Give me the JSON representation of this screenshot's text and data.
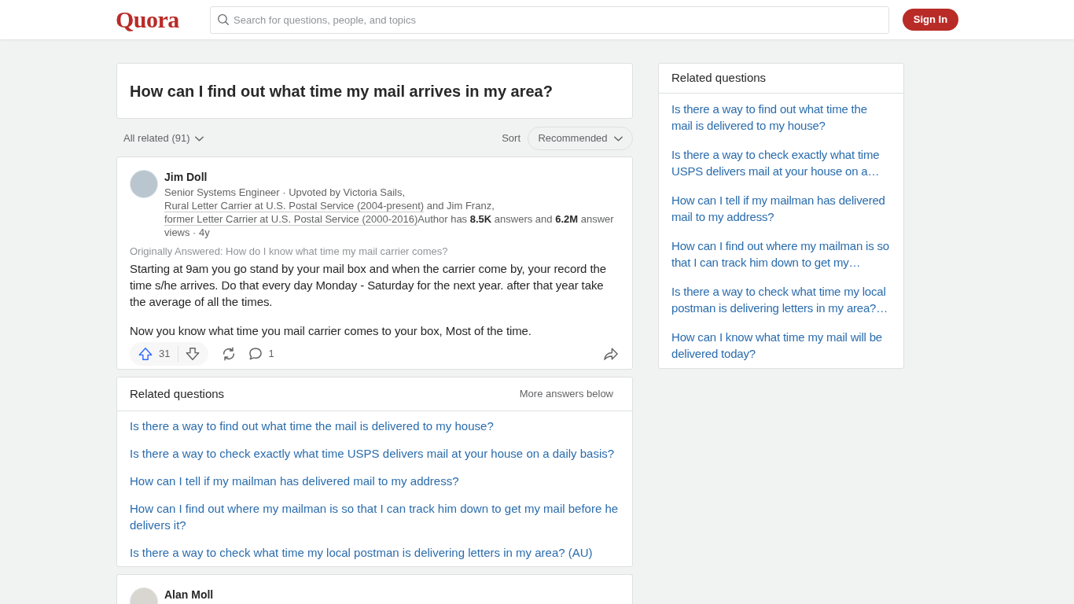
{
  "header": {
    "logo": "Quora",
    "search": {
      "placeholder": "Search for questions, people, and topics"
    },
    "sign_in": "Sign In"
  },
  "question": {
    "title": "How can I find out what time my mail arrives in my area?"
  },
  "filter_bar": {
    "all_related": "All related (91)",
    "sort_label": "Sort",
    "sort_value": "Recommended"
  },
  "answer": {
    "author": "Jim Doll",
    "credential": [
      {
        "kind": "text",
        "text": "Senior Systems Engineer · Upvoted by Victoria Sails, "
      },
      {
        "kind": "link",
        "text": "Rural Letter Carrier at U.S. Postal Service (2004-present)"
      },
      {
        "kind": "text",
        "text": " and Jim Franz, "
      },
      {
        "kind": "link",
        "text": "former Letter Carrier at U.S. Postal Service (2000-2016)"
      },
      {
        "kind": "text",
        "text": "Author has **8.5K** answers and **6.2M** answer views · 4y"
      }
    ],
    "originally_answered": "Originally Answered: How do I know what time my mail carrier comes?",
    "paragraphs": [
      "Starting at 9am you go stand by your mail box and when the carrier come by, your record the time s/he arrives. Do that every day Monday - Saturday for the next year. after that year take the average of all the times.",
      "Now you know what time you mail carrier comes to your box, Most of the time."
    ],
    "upvotes": "31",
    "comments": "1"
  },
  "related_questions": {
    "title": "Related questions",
    "note": "More answers below",
    "items": [
      "Is there a way to find out what time the mail is delivered to my house?",
      "Is there a way to check exactly what time USPS delivers mail at your house on a daily basis?",
      "How can I tell if my mailman has delivered mail to my address?",
      "How can I find out where my mailman is so that I can track him down to get my mail before he delivers it?",
      "Is there a way to check what time my local postman is delivering letters in my area? (AU)"
    ]
  },
  "next_answer": {
    "author": "Alan Moll"
  },
  "sidebar": {
    "title": "Related questions",
    "items": [
      "Is there a way to find out what time the mail is delivered to my house?",
      "Is there a way to check exactly what time USPS delivers mail at your house on a…",
      "How can I tell if my mailman has delivered mail to my address?",
      "How can I find out where my mailman is so that I can track him down to get my…",
      "Is there a way to check what time my local postman is delivering letters in my area?…",
      "How can I know what time my mail will be delivered today?"
    ]
  }
}
